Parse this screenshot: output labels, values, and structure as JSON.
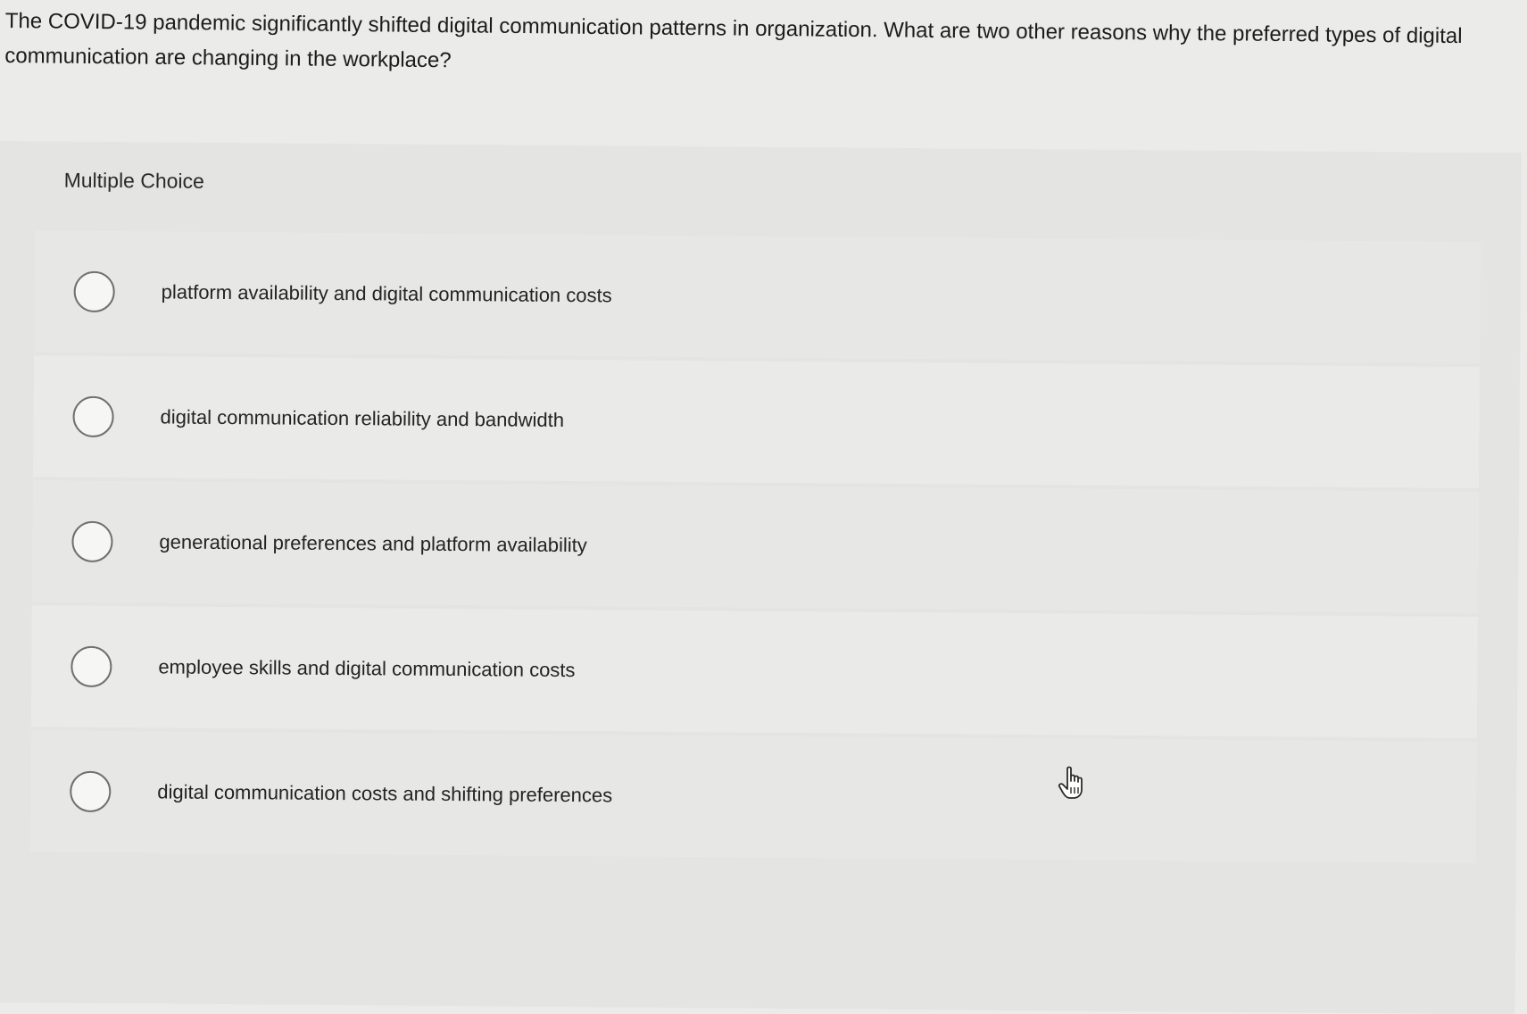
{
  "question": {
    "text": "The COVID-19 pandemic significantly shifted digital communication patterns in organization. What are two other reasons why the preferred types of digital communication are changing in the workplace?"
  },
  "question_type": "Multiple Choice",
  "options": [
    {
      "label": "platform availability and digital communication costs",
      "selected": false
    },
    {
      "label": "digital communication reliability and bandwidth",
      "selected": false
    },
    {
      "label": "generational preferences and platform availability",
      "selected": false
    },
    {
      "label": "employee skills and digital communication costs",
      "selected": false
    },
    {
      "label": "digital communication costs and shifting preferences",
      "selected": false
    }
  ],
  "icons": {
    "radio": "radio-circle-icon",
    "cursor": "hand-pointer-icon"
  },
  "colors": {
    "background": "#ebebea",
    "panel": "#e4e4e3",
    "radio_border": "#707070",
    "text": "#1f1f1f"
  }
}
